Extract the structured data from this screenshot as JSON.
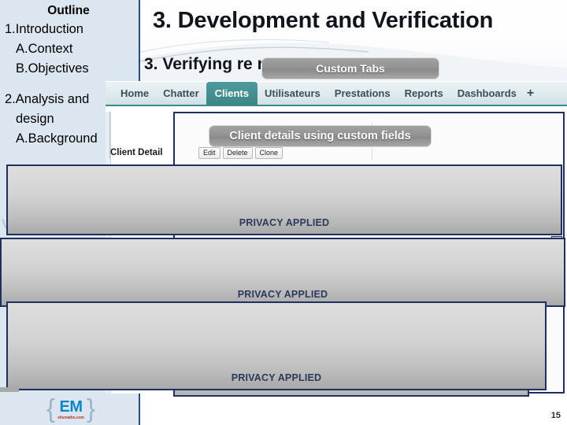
{
  "slide": {
    "title": "3. Development and Verification",
    "subtitle": "3. Verifying re                            m CRM",
    "page_number": "15"
  },
  "sidebar": {
    "heading": "Outline",
    "items": [
      {
        "label": "1.Introduction",
        "level": 1
      },
      {
        "label": "A.Context",
        "level": 2
      },
      {
        "label": "B.Objectives",
        "level": 2
      },
      {
        "label": "2.Analysis and",
        "level": 1
      },
      {
        "label": "design",
        "level": 2
      },
      {
        "label": "A.Background",
        "level": 2
      }
    ]
  },
  "callouts": {
    "custom_tabs": "Custom Tabs",
    "client_details": "Client details using custom fields"
  },
  "app": {
    "tabs": [
      {
        "label": "Home",
        "active": false
      },
      {
        "label": "Chatter",
        "active": false
      },
      {
        "label": "Clients",
        "active": true
      },
      {
        "label": "Utilisateurs",
        "active": false
      },
      {
        "label": "Prestations",
        "active": false
      },
      {
        "label": "Reports",
        "active": false
      },
      {
        "label": "Dashboards",
        "active": false
      }
    ],
    "add_tab_icon": "+",
    "detail": {
      "title": "Client Detail",
      "actions": [
        "Edit",
        "Delete",
        "Clone"
      ]
    }
  },
  "privacy_blocks": [
    {
      "label": "PRIVACY APPLIED"
    },
    {
      "label": "PRIVACY APPLIED"
    },
    {
      "label": "PRIVACY APPLIED"
    }
  ],
  "ghost_glyph": "V",
  "logo": {
    "brace_left": "{",
    "brace_right": "}",
    "mark": "EM",
    "url": "elismaths.com"
  },
  "colors": {
    "sidebar_bg": "#dce6f1",
    "sidebar_border": "#2f4a7c",
    "tab_active": "#3d8688",
    "tabbar_border": "#3b8b8e",
    "privacy_border": "#1f2f5e",
    "privacy_text": "#2b3a5c",
    "callout_bg": "#939393",
    "logo_blue": "#0f86c4",
    "logo_red": "#b03a2e"
  }
}
